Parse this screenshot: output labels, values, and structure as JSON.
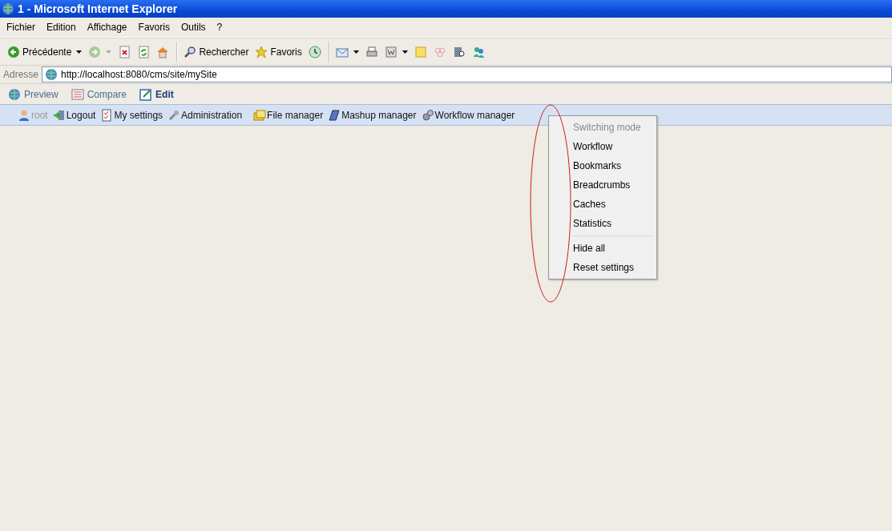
{
  "window": {
    "title": "1 - Microsoft Internet Explorer"
  },
  "menu_bar": [
    "Fichier",
    "Edition",
    "Affichage",
    "Favoris",
    "Outils",
    "?"
  ],
  "toolbar": [
    {
      "kind": "button",
      "label": "Précédente",
      "dropdown": true,
      "disabled": false
    },
    {
      "kind": "button",
      "dropdown": true,
      "disabled": true
    },
    {
      "kind": "button",
      "dropdown": false,
      "disabled": false
    },
    {
      "kind": "button",
      "dropdown": false,
      "disabled": false
    },
    {
      "kind": "button",
      "dropdown": false,
      "disabled": false
    },
    {
      "kind": "separator"
    },
    {
      "kind": "button",
      "label": "Rechercher",
      "dropdown": false,
      "disabled": false
    },
    {
      "kind": "button",
      "label": "Favoris",
      "dropdown": false,
      "disabled": false
    },
    {
      "kind": "button",
      "dropdown": false,
      "disabled": false
    },
    {
      "kind": "separator"
    },
    {
      "kind": "button",
      "dropdown": true,
      "disabled": false
    },
    {
      "kind": "button",
      "dropdown": false,
      "disabled": false
    },
    {
      "kind": "button",
      "dropdown": true,
      "disabled": false
    },
    {
      "kind": "button",
      "dropdown": false,
      "disabled": false
    },
    {
      "kind": "button",
      "dropdown": false,
      "disabled": false
    },
    {
      "kind": "button",
      "dropdown": false,
      "disabled": false
    },
    {
      "kind": "button",
      "dropdown": false,
      "disabled": false
    }
  ],
  "address_bar": {
    "label": "Adresse",
    "value": "http://localhost:8080/cms/site/mySite"
  },
  "cms_tabs": [
    {
      "label": "Preview",
      "selected": false
    },
    {
      "label": "Compare",
      "selected": false
    },
    {
      "label": "Edit",
      "selected": true
    }
  ],
  "cms_bar": [
    {
      "label": "root",
      "disabled": true
    },
    {
      "label": "Logout",
      "disabled": false
    },
    {
      "label": "My settings",
      "disabled": false
    },
    {
      "label": "Administration",
      "disabled": false
    },
    {
      "label": "File manager",
      "disabled": false
    },
    {
      "label": "Mashup manager",
      "disabled": false
    },
    {
      "label": "Workflow manager",
      "disabled": false
    }
  ],
  "context_menu": [
    {
      "kind": "item",
      "label": "Switching mode",
      "disabled": true
    },
    {
      "kind": "item",
      "label": "Workflow",
      "disabled": false
    },
    {
      "kind": "item",
      "label": "Bookmarks",
      "disabled": false
    },
    {
      "kind": "item",
      "label": "Breadcrumbs",
      "disabled": false
    },
    {
      "kind": "item",
      "label": "Caches",
      "disabled": false
    },
    {
      "kind": "item",
      "label": "Statistics",
      "disabled": false
    },
    {
      "kind": "separator"
    },
    {
      "kind": "item",
      "label": "Hide all",
      "disabled": false
    },
    {
      "kind": "item",
      "label": "Reset settings",
      "disabled": false
    }
  ]
}
